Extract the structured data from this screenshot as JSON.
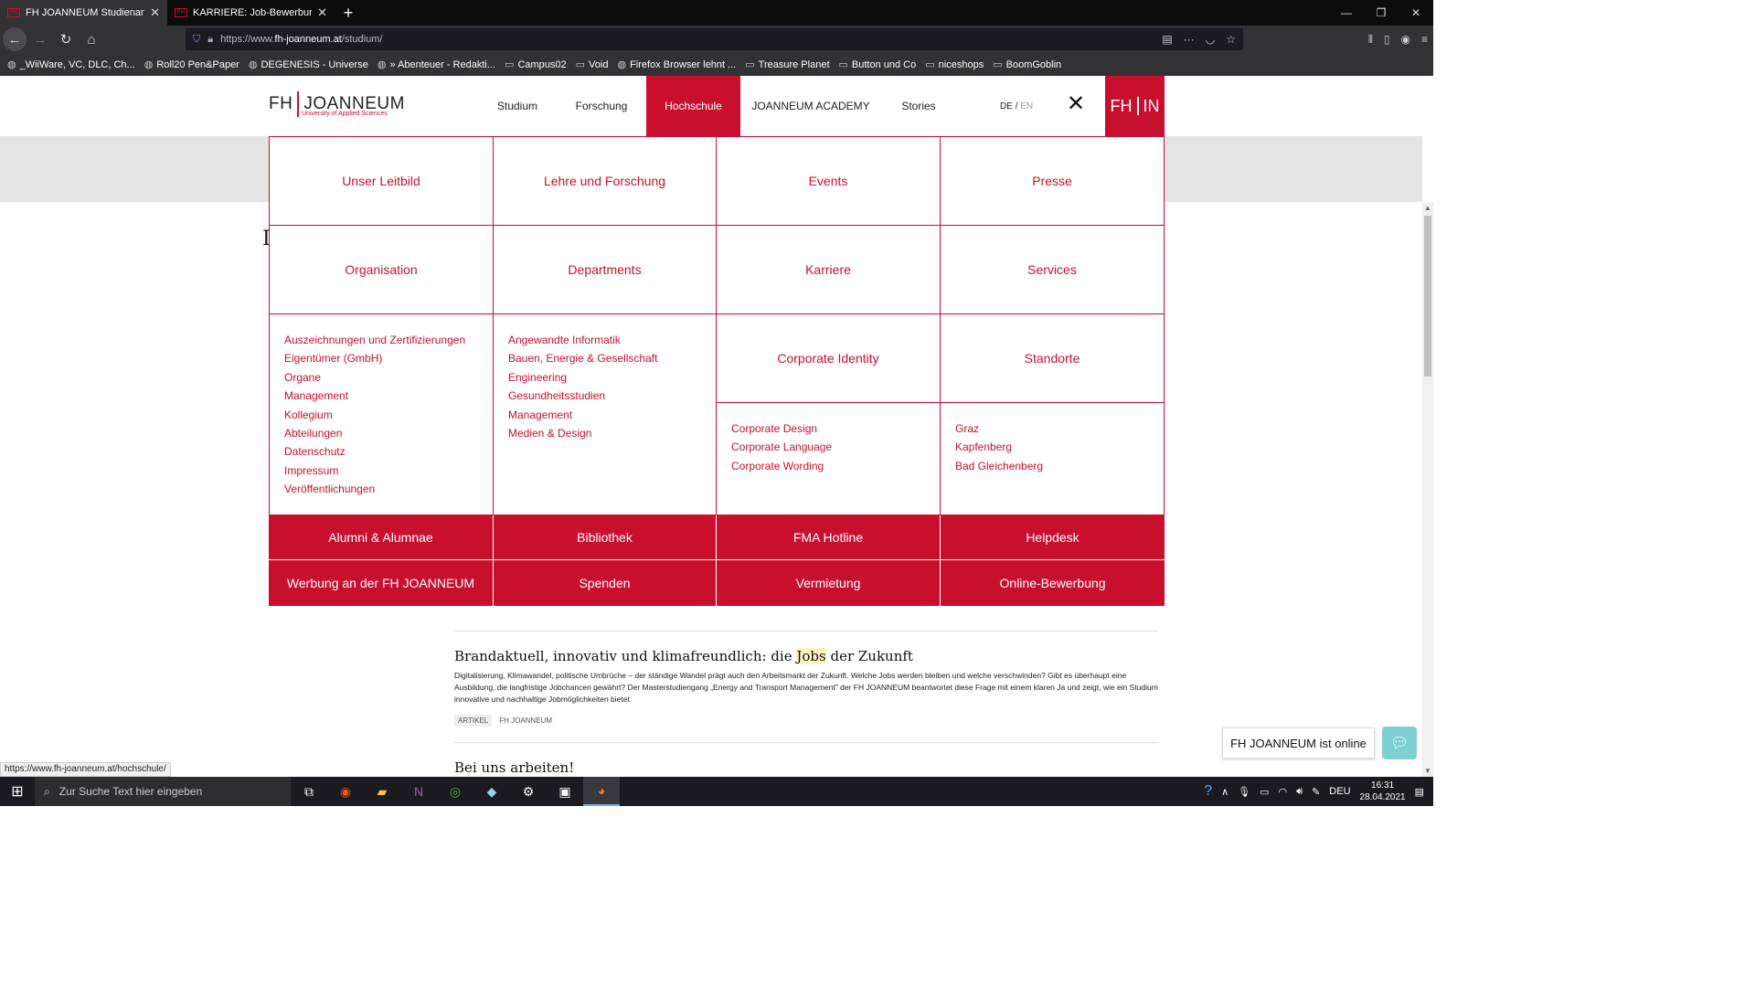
{
  "browser": {
    "tabs": [
      {
        "title": "FH JOANNEUM Studienangebot",
        "active": true
      },
      {
        "title": "KARRIERE: Job-Bewerbung – JOANNEUM",
        "active": false
      }
    ],
    "url_prefix": "https://www.",
    "url_domain": "fh-joanneum.at",
    "url_path": "/studium/",
    "bookmarks": [
      "_WiiWare, VC, DLC, Ch...",
      "Roll20 Pen&Paper",
      "DEGENESIS - Universe",
      "» Abenteuer - Redakti...",
      "Campus02",
      "Void",
      "Firefox Browser lehnt ...",
      "Treasure Planet",
      "Button und Co",
      "niceshops",
      "BoomGoblin"
    ],
    "status_url": "https://www.fh-joanneum.at/hochschule/"
  },
  "site": {
    "logo_main_left": "FH",
    "logo_main_right": "JOANNEUM",
    "logo_sub": "University of Applied Sciences",
    "nav": [
      "Studium",
      "Forschung",
      "Hochschule",
      "JOANNEUM ACADEMY",
      "Stories"
    ],
    "lang_de": "DE",
    "lang_sep": "/",
    "lang_en": "EN",
    "close_symbol": "✕",
    "fhin_left": "FH",
    "fhin_right": "IN"
  },
  "menu": {
    "row1": [
      "Unser Leitbild",
      "Lehre und Forschung",
      "Events",
      "Presse"
    ],
    "row2": [
      "Organisation",
      "Departments",
      "Karriere",
      "Services"
    ],
    "org_links": [
      "Auszeichnungen und Zertifizierungen",
      "Eigentümer (GmbH)",
      "Organe",
      "Management",
      "Kollegium",
      "Abteilungen",
      "Datenschutz",
      "Impressum",
      "Veröffentlichungen"
    ],
    "dept_links": [
      "Angewandte Informatik",
      "Bauen, Energie & Gesellschaft",
      "Engineering",
      "Gesundheitsstudien",
      "Management",
      "Medien & Design"
    ],
    "corporate_identity": "Corporate Identity",
    "standorte": "Standorte",
    "ci_links": [
      "Corporate Design",
      "Corporate Language",
      "Corporate Wording"
    ],
    "standorte_links": [
      "Graz",
      "Kapfenberg",
      "Bad Gleichenberg"
    ],
    "red_row1": [
      "Alumni & Alumnae",
      "Bibliothek",
      "FMA Hotline",
      "Helpdesk"
    ],
    "red_row2": [
      "Werbung an der FH JOANNEUM",
      "Spenden",
      "Vermietung",
      "Online-Bewerbung"
    ]
  },
  "article": {
    "title_part1": "Brandaktuell, innovativ und klimafreundlich: die ",
    "title_highlight": "Jobs",
    "title_part2": " der Zukunft",
    "body": "Digitalisierung, Klimawandel, politische Umbrüche – der ständige Wandel prägt auch den Arbeitsmarkt der Zukunft. Welche Jobs werden bleiben und welche verschwinden? Gibt es überhaupt eine Ausbildung, die langfristige Jobchancen gewährt? Der Masterstudiengang „Energy and Transport Management\" der FH JOANNEUM beantwortet diese Frage mit einem klaren Ja und zeigt, wie ein Studium innovative und nachhaltige Jobmöglichkeiten bietet.",
    "tag1": "ARTIKEL",
    "tag2": "FH JOANNEUM",
    "next_title": "Bei uns arbeiten!"
  },
  "chat": {
    "label": "FH JOANNEUM ist online"
  },
  "taskbar": {
    "search_placeholder": "Zur Suche Text hier eingeben",
    "lang": "DEU",
    "time": "16:31",
    "date": "28.04.2021"
  }
}
